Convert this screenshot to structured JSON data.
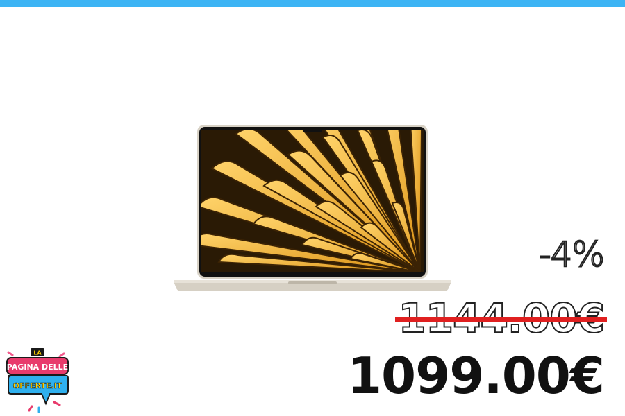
{
  "accent_color": "#3cb4f4",
  "product": {
    "image": "macbook-air-starlight"
  },
  "pricing": {
    "discount": "-4%",
    "old_price": "1144.00€",
    "new_price": "1099.00€",
    "strike_color": "#e02020"
  },
  "logo": {
    "line1": "LA",
    "line2": "PAGINA DELLE",
    "line3": "OFFERTE.IT"
  }
}
